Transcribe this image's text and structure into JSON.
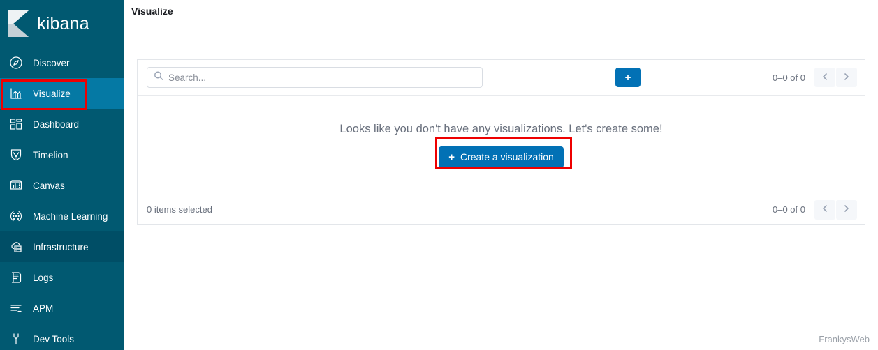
{
  "brand": {
    "name": "kibana",
    "logo_icon": "kibana-k-logo"
  },
  "sidebar": {
    "items": [
      {
        "label": "Discover",
        "icon": "compass-icon",
        "state": "default"
      },
      {
        "label": "Visualize",
        "icon": "bar-chart-icon",
        "state": "active"
      },
      {
        "label": "Dashboard",
        "icon": "dashboard-grid-icon",
        "state": "default"
      },
      {
        "label": "Timelion",
        "icon": "shield-timelion-icon",
        "state": "default"
      },
      {
        "label": "Canvas",
        "icon": "canvas-frame-icon",
        "state": "default"
      },
      {
        "label": "Machine Learning",
        "icon": "machine-learning-icon",
        "state": "default"
      },
      {
        "label": "Infrastructure",
        "icon": "cloud-server-icon",
        "state": "hovered"
      },
      {
        "label": "Logs",
        "icon": "logs-scroll-icon",
        "state": "default"
      },
      {
        "label": "APM",
        "icon": "apm-lines-icon",
        "state": "default"
      },
      {
        "label": "Dev Tools",
        "icon": "wrench-icon",
        "state": "default"
      }
    ]
  },
  "header": {
    "title": "Visualize"
  },
  "toolbar": {
    "search_placeholder": "Search...",
    "search_value": "",
    "search_icon": "search-icon",
    "add_label": "+",
    "add_icon": "plus-icon",
    "pagination_label": "0–0 of 0",
    "prev_icon": "chevron-left-icon",
    "next_icon": "chevron-right-icon"
  },
  "empty_state": {
    "message": "Looks like you don't have any visualizations. Let's create some!",
    "create_label": "Create a visualization",
    "create_plus": "+"
  },
  "footer": {
    "selected_label": "0 items selected",
    "pagination_label": "0–0 of 0",
    "prev_icon": "chevron-left-icon",
    "next_icon": "chevron-right-icon"
  },
  "watermark": {
    "text": "FrankysWeb"
  },
  "colors": {
    "sidebar_bg": "#015971",
    "sidebar_active": "#0579a4",
    "sidebar_hover": "#004e66",
    "accent_blue": "#0271b5",
    "annotation_red": "#ee0000",
    "muted_text": "#69707d"
  }
}
